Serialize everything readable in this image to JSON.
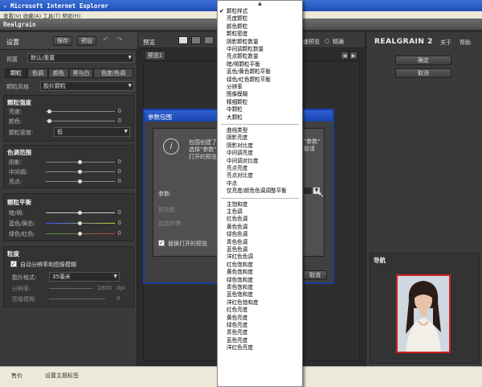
{
  "ie_title": "- Microsoft Internet Explorer",
  "ie_menu": "查看(V)    收藏(A)    工具(T)    帮助(H)",
  "rg_title": "Realgrain",
  "left": {
    "settings_label": "设置",
    "save_label": "保存",
    "preset_label": "预设",
    "undo_symbol": "↶",
    "redo_symbol": "↷",
    "preset_row_label": "预置",
    "preset_value": "默认/重置",
    "tabs": [
      "颗粒",
      "色调",
      "颜色",
      "黑与白",
      "色度/色调"
    ],
    "grain_style_label": "颗粒风格",
    "grain_style_value": "胶片颗粒",
    "grain_strength": {
      "title": "颗粒强度",
      "rows": [
        {
          "label": "亮度:",
          "value": "0"
        },
        {
          "label": "颜色:",
          "value": "0"
        }
      ],
      "density_label": "颗粒密度:",
      "density_value": "低"
    },
    "tone_range": {
      "title": "色调范围",
      "rows": [
        {
          "label": "阴影:",
          "value": "0"
        },
        {
          "label": "中间调:",
          "value": "0"
        },
        {
          "label": "亮点:",
          "value": "0"
        }
      ]
    },
    "grain_balance": {
      "title": "颗粒平衡",
      "rows": [
        {
          "label": "暗/明:",
          "value": "0"
        },
        {
          "label": "蓝色/黄色:",
          "value": "0"
        },
        {
          "label": "绿色/红色:",
          "value": "0"
        }
      ]
    },
    "grain_size": {
      "title": "粒度",
      "auto_label": "自动分辨率和图像模糊",
      "film_format_label": "胶片格式:",
      "film_format_value": "35毫米",
      "resolution_label": "分辨率:",
      "resolution_value": "1800",
      "resolution_unit": "dpi",
      "blur_label": "图像模糊:",
      "blur_value": "0"
    }
  },
  "center": {
    "preview_label": "预览",
    "quick_preview_label": "快速预览",
    "accurate_label": "精确",
    "tab_label": "预览1"
  },
  "dialog": {
    "title": "参数包围",
    "info_line1": "包围创建了一",
    "info_line2": "选择\"参数\"，",
    "info_line3": "打开的预览",
    "info_tail1": "\"参数\"",
    "info_tail2": "前请",
    "param_label": "参数:",
    "preview_count_label": "预览数:",
    "color_step_label": "包围步骤:",
    "replace_label": "替换打开的预览",
    "cancel_label": "取消"
  },
  "right": {
    "logo": "REALGRAIN 2",
    "about_label": "关于",
    "help_label": "帮助",
    "ok_label": "确定",
    "cancel_label": "取消",
    "nav_label": "导航"
  },
  "status": {
    "items": [
      "售价",
      "设置主题标签"
    ]
  },
  "menu": {
    "items": [
      {
        "label": "颗粒样式",
        "checked": true
      },
      {
        "label": "亮度颗粒"
      },
      {
        "label": "颜色颗粒"
      },
      {
        "label": "颗粒密度"
      },
      {
        "label": "阴影颗粒数量"
      },
      {
        "label": "中间调颗粒数量"
      },
      {
        "label": "亮点颗粒数量"
      },
      {
        "label": "暗/明颗粒平衡"
      },
      {
        "label": "蓝色/黄色颗粒平衡"
      },
      {
        "label": "绿色/红色颗粒平衡"
      },
      {
        "label": "分辨率"
      },
      {
        "label": "图像模糊"
      },
      {
        "label": "精细颗粒"
      },
      {
        "label": "中颗粒"
      },
      {
        "label": "大颗粒"
      },
      {
        "sep": true
      },
      {
        "label": "曲线类型"
      },
      {
        "label": "阴影亮度"
      },
      {
        "label": "阴影对比度"
      },
      {
        "label": "中间调亮度"
      },
      {
        "label": "中间调对比度"
      },
      {
        "label": "亮点亮度"
      },
      {
        "label": "亮点对比度"
      },
      {
        "label": "中点"
      },
      {
        "label": "仅亮度/颜色色调调整平衡"
      },
      {
        "sep": true
      },
      {
        "label": "主饱和度"
      },
      {
        "label": "主色调"
      },
      {
        "label": "红色色调"
      },
      {
        "label": "黄色色调"
      },
      {
        "label": "绿色色调"
      },
      {
        "label": "青色色调"
      },
      {
        "label": "蓝色色调"
      },
      {
        "label": "洋红色色调"
      },
      {
        "label": "红色饱和度"
      },
      {
        "label": "黄色饱和度"
      },
      {
        "label": "绿色饱和度"
      },
      {
        "label": "青色饱和度"
      },
      {
        "label": "蓝色饱和度"
      },
      {
        "label": "洋红色饱和度"
      },
      {
        "label": "红色亮度"
      },
      {
        "label": "黄色亮度"
      },
      {
        "label": "绿色亮度"
      },
      {
        "label": "青色亮度"
      },
      {
        "label": "蓝色亮度"
      },
      {
        "label": "洋红色亮度"
      }
    ]
  }
}
